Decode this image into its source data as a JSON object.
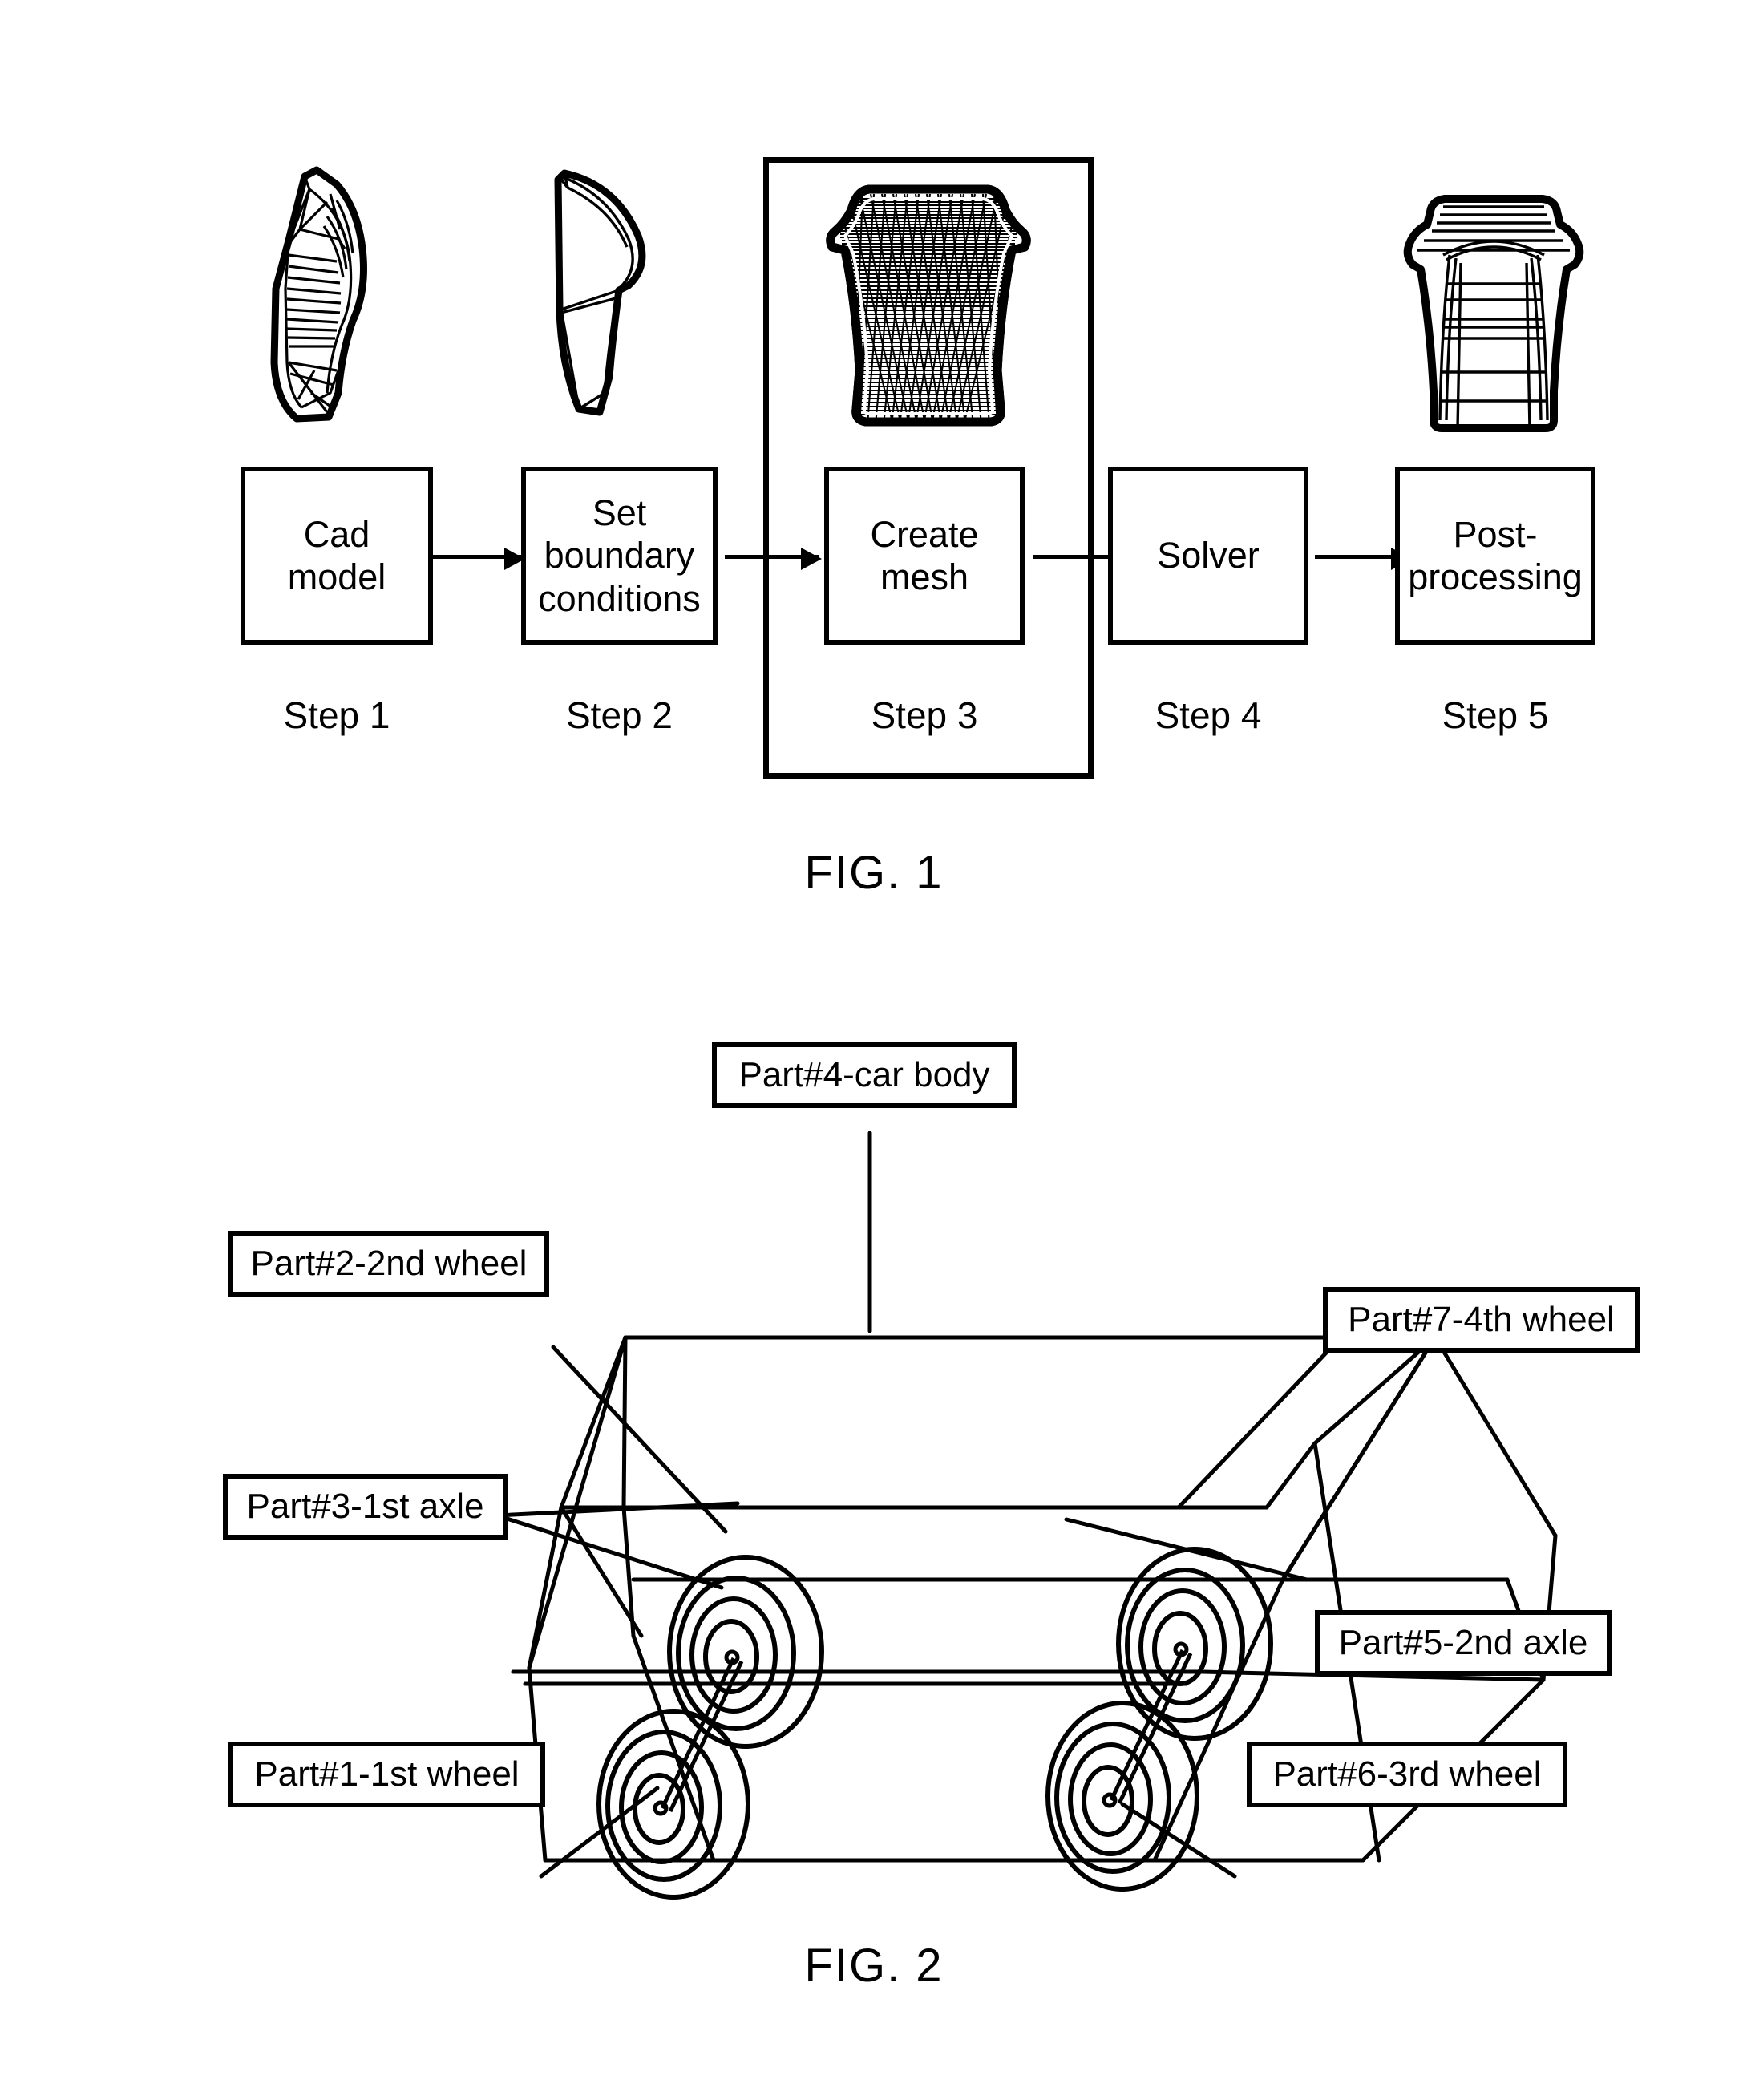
{
  "figure1": {
    "caption": "FIG. 1",
    "steps": [
      {
        "box_label": "Cad\nmodel",
        "step_label": "Step 1",
        "art": "cad-model-blade"
      },
      {
        "box_label": "Set\nboundary\nconditions",
        "step_label": "Step 2",
        "art": "boundary-conditions-blade"
      },
      {
        "box_label": "Create\nmesh",
        "step_label": "Step 3",
        "art": "meshed-blade"
      },
      {
        "box_label": "Solver",
        "step_label": "Step 4",
        "art": "none"
      },
      {
        "box_label": "Post-\nprocessing",
        "step_label": "Step 5",
        "art": "postprocessed-blade"
      }
    ],
    "highlighted_step": "Step 3"
  },
  "figure2": {
    "caption": "FIG. 2",
    "callouts": [
      {
        "id": "part4",
        "label": "Part#4-car body"
      },
      {
        "id": "part2",
        "label": "Part#2-2nd wheel"
      },
      {
        "id": "part7",
        "label": "Part#7-4th wheel"
      },
      {
        "id": "part3",
        "label": "Part#3-1st axle"
      },
      {
        "id": "part5",
        "label": "Part#5-2nd axle"
      },
      {
        "id": "part1",
        "label": "Part#1-1st wheel"
      },
      {
        "id": "part6",
        "label": "Part#6-3rd wheel"
      }
    ]
  },
  "colors": {
    "line": "#000000",
    "background": "#ffffff"
  }
}
